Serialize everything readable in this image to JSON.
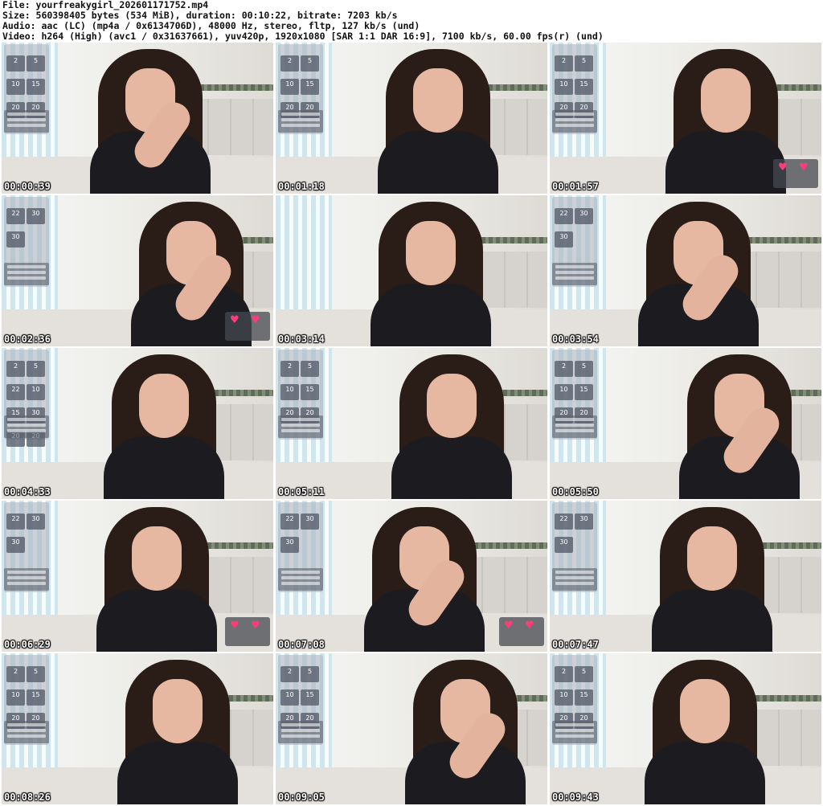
{
  "header": {
    "file": "File: yourfreakygirl_202601171752.mp4",
    "size": "Size: 560398405 bytes (534 MiB), duration: 00:10:22, bitrate: 7203 kb/s",
    "audio": "Audio: aac (LC) (mp4a / 0x6134706D), 48000 Hz, stereo, fltp, 127 kb/s (und)",
    "video": "Video: h264 (High) (avc1 / 0x31637661), yuv420p, 1920x1080 [SAR 1:1 DAR 16:9], 7100 kb/s, 60.00 fps(r) (und)"
  },
  "thumbnails": [
    {
      "time": "00:00:39",
      "tiles": [
        "2",
        "5",
        "10",
        "15",
        "20",
        "20"
      ],
      "reward": false
    },
    {
      "time": "00:01:18",
      "tiles": [
        "2",
        "5",
        "10",
        "15",
        "20",
        "20"
      ],
      "reward": false
    },
    {
      "time": "00:01:57",
      "tiles": [
        "2",
        "5",
        "10",
        "15",
        "20",
        "20"
      ],
      "reward": true
    },
    {
      "time": "00:02:36",
      "tiles": [
        "22",
        "30",
        "30"
      ],
      "reward": true
    },
    {
      "time": "00:03:14",
      "tiles": [],
      "reward": false
    },
    {
      "time": "00:03:54",
      "tiles": [
        "22",
        "30",
        "30"
      ],
      "reward": false
    },
    {
      "time": "00:04:33",
      "tiles": [
        "2",
        "5",
        "22",
        "10",
        "15",
        "30",
        "20",
        "20"
      ],
      "reward": false
    },
    {
      "time": "00:05:11",
      "tiles": [
        "2",
        "5",
        "10",
        "15",
        "20",
        "20"
      ],
      "reward": false
    },
    {
      "time": "00:05:50",
      "tiles": [
        "2",
        "5",
        "10",
        "15",
        "20",
        "20"
      ],
      "reward": false
    },
    {
      "time": "00:06:29",
      "tiles": [
        "22",
        "30",
        "30"
      ],
      "reward": true
    },
    {
      "time": "00:07:08",
      "tiles": [
        "22",
        "30",
        "30"
      ],
      "reward": true
    },
    {
      "time": "00:07:47",
      "tiles": [
        "22",
        "30",
        "30"
      ],
      "reward": false
    },
    {
      "time": "00:08:26",
      "tiles": [
        "2",
        "5",
        "10",
        "15",
        "20",
        "20"
      ],
      "reward": false
    },
    {
      "time": "00:09:05",
      "tiles": [
        "2",
        "5",
        "10",
        "15",
        "20",
        "20"
      ],
      "reward": false
    },
    {
      "time": "00:09:43",
      "tiles": [
        "2",
        "5",
        "10",
        "15",
        "20",
        "20"
      ],
      "reward": false
    }
  ],
  "colors": {
    "timestamp": "#ffffff",
    "accent": "#e8306a",
    "shirt": "#1c1c20",
    "hair": "#2a1c17"
  }
}
